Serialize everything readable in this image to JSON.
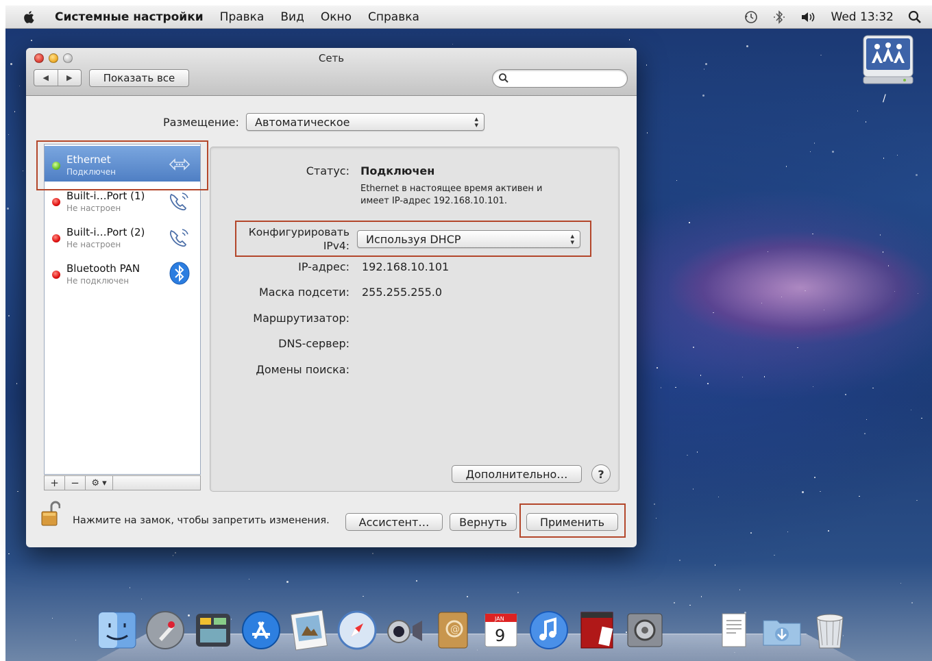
{
  "menubar": {
    "app_name": "Системные настройки",
    "items": [
      "Правка",
      "Вид",
      "Окно",
      "Справка"
    ],
    "clock": "Wed 13:32"
  },
  "desktop": {
    "network_drive_label": "/"
  },
  "window": {
    "title": "Сеть",
    "show_all_label": "Показать все",
    "search_placeholder": "",
    "location_label": "Размещение:",
    "location_value": "Автоматическое"
  },
  "services": [
    {
      "name": "Ethernet",
      "status": "Подключен",
      "state": "connected",
      "icon": "ethernet-icon",
      "selected": true
    },
    {
      "name": "Built-i…Port (1)",
      "status": "Не настроен",
      "state": "not-configured",
      "icon": "phone-modem-icon",
      "selected": false
    },
    {
      "name": "Built-i…Port (2)",
      "status": "Не настроен",
      "state": "not-configured",
      "icon": "phone-modem-icon",
      "selected": false
    },
    {
      "name": "Bluetooth PAN",
      "status": "Не подключен",
      "state": "disconnected",
      "icon": "bluetooth-icon",
      "selected": false
    }
  ],
  "list_buttons": {
    "add": "+",
    "remove": "−",
    "gear": "⚙ ▾"
  },
  "detail": {
    "status_label": "Статус:",
    "status_value": "Подключен",
    "status_desc_line1": "Ethernet в настоящее время активен и",
    "status_desc_line2": "имеет IP-адрес 192.168.10.101.",
    "config_label_line1": "Конфигурировать",
    "config_label_line2": "IPv4:",
    "config_value": "Используя DHCP",
    "ip_label": "IP-адрес:",
    "ip_value": "192.168.10.101",
    "mask_label": "Маска подсети:",
    "mask_value": "255.255.255.0",
    "router_label": "Маршрутизатор:",
    "dns_label": "DNS-сервер:",
    "search_domains_label": "Домены поиска:",
    "advanced_label": "Дополнительно…",
    "help_label": "?"
  },
  "footer": {
    "lock_text": "Нажмите на замок, чтобы запретить изменения.",
    "assistant_label": "Ассистент…",
    "revert_label": "Вернуть",
    "apply_label": "Применить"
  },
  "dock": {
    "calendar_month": "JAN",
    "calendar_day": "9",
    "items": [
      "finder-icon",
      "launchpad-icon",
      "dashboard-icon",
      "app-store-icon",
      "preview-icon",
      "safari-icon",
      "facetime-icon",
      "address-book-icon",
      "calendar-icon",
      "itunes-icon",
      "photo-booth-icon",
      "system-preferences-icon",
      "documents-stack-icon",
      "downloads-folder-icon",
      "trash-icon"
    ]
  },
  "colors": {
    "highlight_border": "#b3462a",
    "selection_blue": "#5f8fd2"
  }
}
